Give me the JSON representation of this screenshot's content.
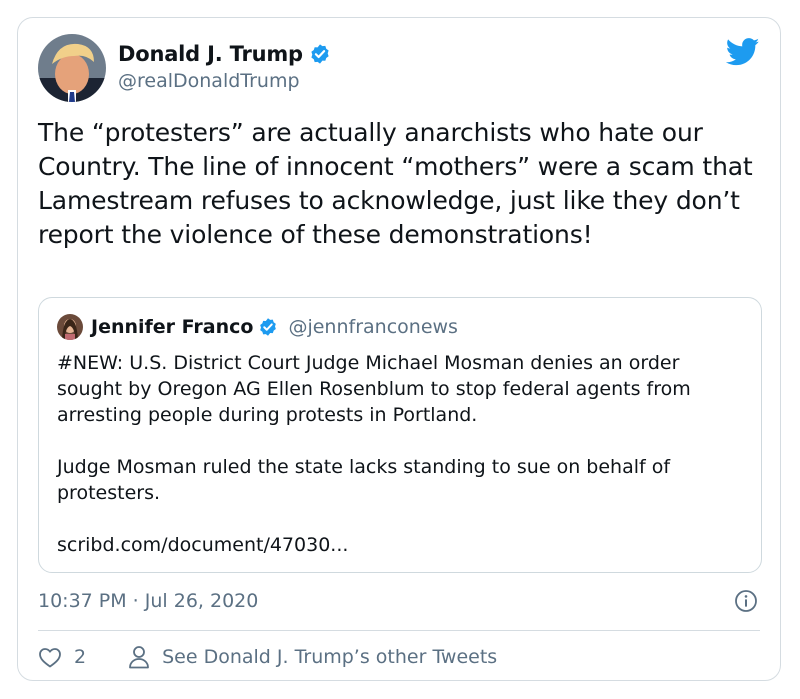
{
  "author": {
    "name": "Donald J. Trump",
    "handle": "@realDonaldTrump"
  },
  "tweet": {
    "text": "The “protesters” are actually anarchists who hate our Country. The line of innocent “mothers” were a scam that Lamestream refuses to acknowledge, just like they don’t report the violence of these demonstrations!"
  },
  "quoted": {
    "name": "Jennifer Franco",
    "handle": "@jennfranconews",
    "paragraph1": "#NEW: U.S. District Court Judge Michael Mosman denies an order sought by Oregon AG Ellen Rosenblum to stop federal agents from arresting people during protests in Portland.",
    "paragraph2": "Judge Mosman ruled the state lacks standing to sue on behalf of protesters.",
    "link": "scribd.com/document/47030..."
  },
  "meta": {
    "timestamp": "10:37 PM · Jul 26, 2020"
  },
  "actions": {
    "like_count": "2",
    "other_tweets_label": "See Donald J. Trump’s other Tweets"
  },
  "colors": {
    "twitter_blue": "#1d9bf0",
    "secondary_text": "#5b7083"
  }
}
